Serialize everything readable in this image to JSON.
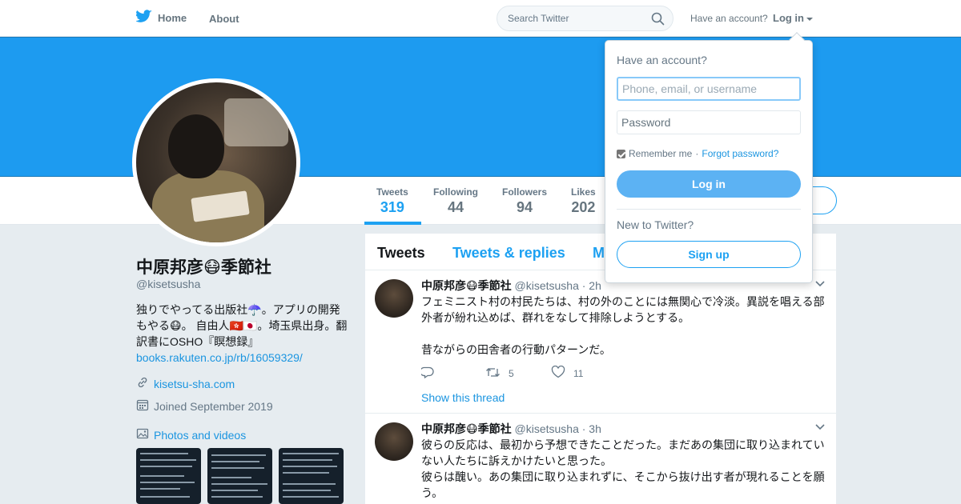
{
  "nav": {
    "home_label": "Home",
    "about_label": "About",
    "search_placeholder": "Search Twitter",
    "have_account": "Have an account?",
    "login_label": "Log in"
  },
  "colors": {
    "accent": "#1da1f2",
    "banner": "#1d9bf0",
    "link": "#1b95e0"
  },
  "icons": {
    "logo": "twitter-bird-icon",
    "search": "magnifier-icon",
    "link": "link-icon",
    "calendar": "calendar-icon",
    "photos": "image-icon",
    "reply": "reply-icon",
    "retweet": "retweet-icon",
    "like": "heart-icon",
    "menu": "chevron-down-icon"
  },
  "stats": [
    {
      "label": "Tweets",
      "value": "319"
    },
    {
      "label": "Following",
      "value": "44"
    },
    {
      "label": "Followers",
      "value": "94"
    },
    {
      "label": "Likes",
      "value": "202"
    }
  ],
  "profile": {
    "name": "中原邦彦😷季節社",
    "handle": "@kisetsusha",
    "bio_text": "独りでやってる出版社☂️。アプリの開発もやる😷。 自由人🇭🇰🇯🇵。埼玉県出身。翻訳書にOSHO『瞑想録』",
    "bio_link": "books.rakuten.co.jp/rb/16059329/",
    "website": "kisetsu-sha.com",
    "joined": "Joined September 2019",
    "photos_label": "Photos and videos"
  },
  "tabs": [
    {
      "label": "Tweets"
    },
    {
      "label": "Tweets & replies"
    },
    {
      "label": "M"
    }
  ],
  "tweets": [
    {
      "name": "中原邦彦😷季節社",
      "handle": "@kisetsusha",
      "time": "· 2h",
      "text": "フェミニスト村の村民たちは、村の外のことには無関心で冷淡。異説を唱える部外者が紛れ込めば、群れをなして排除しようとする。\n\n昔ながらの田舎者の行動パターンだ。",
      "replies": "",
      "retweets": "5",
      "likes": "11",
      "show_thread": "Show this thread"
    },
    {
      "name": "中原邦彦😷季節社",
      "handle": "@kisetsusha",
      "time": "· 3h",
      "text": "彼らの反応は、最初から予想できたことだった。まだあの集団に取り込まれていない人たちに訴えかけたいと思った。\n彼らは醜い。あの集団に取り込まれずに、そこから抜け出す者が現れることを願う。"
    }
  ],
  "login_dropdown": {
    "title": "Have an account?",
    "username_placeholder": "Phone, email, or username",
    "password_placeholder": "Password",
    "remember": "Remember me",
    "separator": "·",
    "forgot": "Forgot password?",
    "login_button": "Log in",
    "new_to_twitter": "New to Twitter?",
    "signup_button": "Sign up"
  }
}
